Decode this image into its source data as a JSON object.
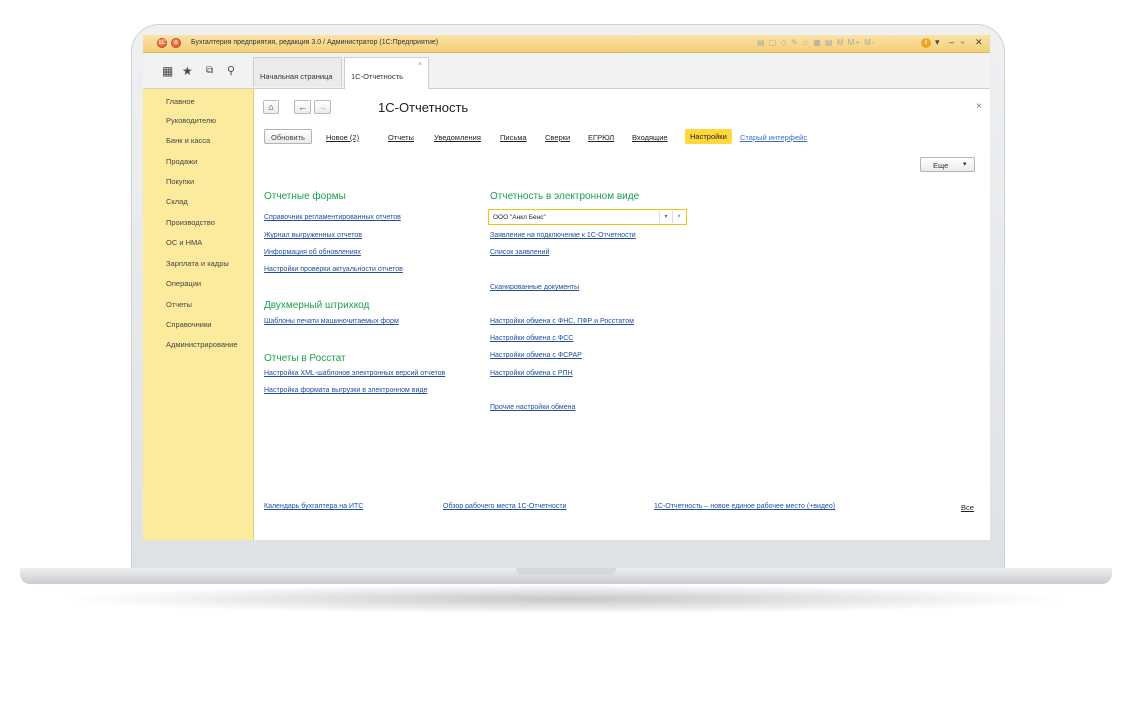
{
  "window": {
    "title": "Бухгалтерия предприятия, редакция 3.0 / Администратор  (1С:Предприятие)",
    "toolbar_icons": "▤ ▢ ◇ ✎ ☆ ▦ ▤ M M+ M-",
    "info": "i"
  },
  "tabs": [
    {
      "label": "Начальная страница"
    },
    {
      "label": "1С-Отчетность",
      "close": "×"
    }
  ],
  "sidebar": {
    "items": [
      {
        "label": "Главное"
      },
      {
        "label": "Руководителю"
      },
      {
        "label": "Банк и касса"
      },
      {
        "label": "Продажи"
      },
      {
        "label": "Покупки"
      },
      {
        "label": "Склад"
      },
      {
        "label": "Производство"
      },
      {
        "label": "ОС и НМА"
      },
      {
        "label": "Зарплата и кадры"
      },
      {
        "label": "Операции"
      },
      {
        "label": "Отчеты"
      },
      {
        "label": "Справочники"
      },
      {
        "label": "Администрирование"
      }
    ]
  },
  "page": {
    "title": "1С-Отчетность",
    "close": "×"
  },
  "commands": {
    "refresh": "Обновить",
    "new": "Новое (2)",
    "reports": "Отчеты",
    "notifications": "Уведомления",
    "letters": "Письма",
    "reconciliations": "Сверки",
    "egrul": "ЕГРЮЛ",
    "incoming": "Входящие",
    "settings": "Настройки",
    "old_interface": "Старый интерфейс",
    "more": "Еще"
  },
  "left_column": {
    "reporting_forms": {
      "title": "Отчетные формы",
      "links": [
        "Справочник регламентированных отчетов",
        "Журнал выгруженных отчетов",
        "Информация об обновлениях",
        "Настройки проверки актуальности отчетов"
      ]
    },
    "barcode": {
      "title": "Двухмерный штрихкод",
      "links": [
        "Шаблоны печати машиночитаемых форм"
      ]
    },
    "rosstat": {
      "title": "Отчеты в Росстат",
      "links": [
        "Настройка XML-шаблонов электронных версий отчетов",
        "Настройка формата выгрузки в электронном виде"
      ]
    }
  },
  "right_column": {
    "title": "Отчетность в электронном виде",
    "organization": "ООО \"Анкл Бенс\"",
    "links_top": [
      "Заявление на подключение к 1С-Отчетности",
      "Список заявлений"
    ],
    "scanned": "Сканированные документы",
    "exchange_links": [
      "Настройки обмена с ФНС, ПФР и Росстатом",
      "Настройки обмена с ФСС",
      "Настройки обмена с ФСРАР",
      "Настройки обмена с РПН"
    ],
    "other": "Прочие настройки обмена"
  },
  "bottom_links": {
    "calendar": "Календарь бухгалтера на ИТС",
    "overview": "Обзор рабочего места 1С-Отчетности",
    "video": "1С-Отчетность – новое единое рабочее место (+видео)",
    "all": "Все"
  }
}
